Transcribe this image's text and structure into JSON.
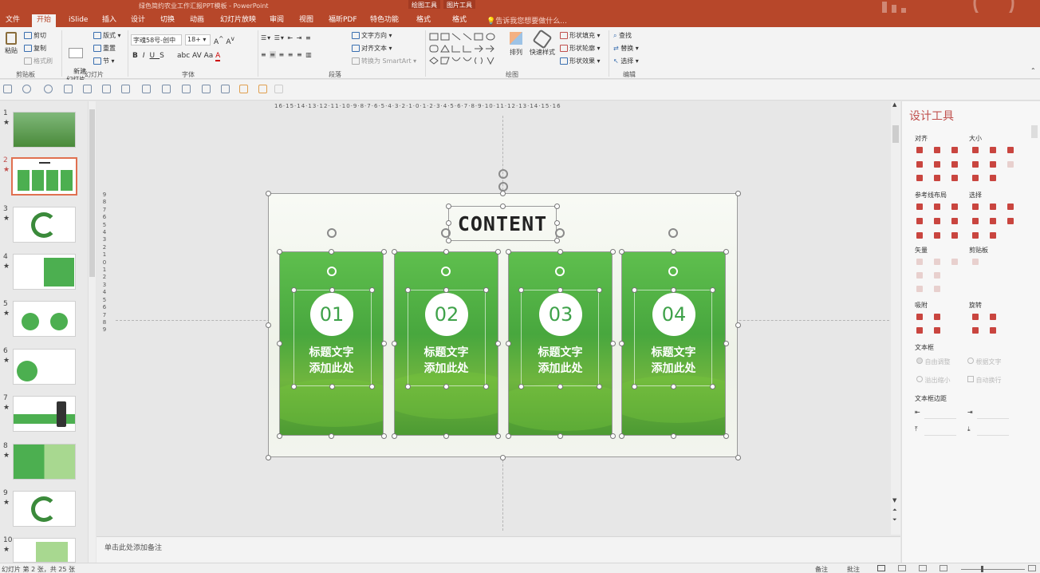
{
  "window": {
    "title": "绿色简约农业工作汇报PPT模板 - PowerPoint",
    "context_tabs": [
      "绘图工具",
      "图片工具"
    ]
  },
  "tabs": [
    "文件",
    "开始",
    "iSlide",
    "插入",
    "设计",
    "切换",
    "动画",
    "幻灯片放映",
    "审阅",
    "视图",
    "福昕PDF",
    "特色功能",
    "格式",
    "格式"
  ],
  "active_tab": "开始",
  "tell_me": "告诉我您想要做什么...",
  "ribbon": {
    "clipboard": {
      "paste": "粘贴",
      "cut": "剪切",
      "copy": "复制",
      "format_painter": "格式刷",
      "group": "剪贴板"
    },
    "slides": {
      "new_slide": "新建\n幻灯片",
      "layout": "版式",
      "reset": "重置",
      "section": "节",
      "group": "幻灯片"
    },
    "font": {
      "font_name": "字魂58号-创中",
      "font_size": "18+",
      "group": "字体"
    },
    "paragraph": {
      "text_direction": "文字方向",
      "align_text": "对齐文本",
      "smartart": "转换为 SmartArt",
      "group": "段落"
    },
    "drawing": {
      "arrange": "排列",
      "quick_styles": "快速样式",
      "fill": "形状填充",
      "outline": "形状轮廓",
      "effects": "形状效果",
      "group": "绘图"
    },
    "editing": {
      "find": "查找",
      "replace": "替换",
      "select": "选择",
      "group": "编辑"
    }
  },
  "thumbnails": [
    {
      "num": "1",
      "star": "★"
    },
    {
      "num": "2",
      "star": "★"
    },
    {
      "num": "3",
      "star": "★"
    },
    {
      "num": "4",
      "star": "★"
    },
    {
      "num": "5",
      "star": "★"
    },
    {
      "num": "6",
      "star": "★"
    },
    {
      "num": "7",
      "star": "★"
    },
    {
      "num": "8",
      "star": "★"
    },
    {
      "num": "9",
      "star": "★"
    },
    {
      "num": "10",
      "star": "★"
    }
  ],
  "selected_slide": "2",
  "rulers": {
    "horizontal": "16·15·14·13·12·11·10·9·8·7·6·5·4·3·2·1·0·1·2·3·4·5·6·7·8·9·10·11·12·13·14·15·16",
    "vertical": [
      "9",
      "8",
      "7",
      "6",
      "5",
      "4",
      "3",
      "2",
      "1",
      "0",
      "1",
      "2",
      "3",
      "4",
      "5",
      "6",
      "7",
      "8",
      "9"
    ]
  },
  "slide": {
    "title": "CONTENT",
    "cards": [
      {
        "num": "01",
        "line1": "标题文字",
        "line2": "添加此处"
      },
      {
        "num": "02",
        "line1": "标题文字",
        "line2": "添加此处"
      },
      {
        "num": "03",
        "line1": "标题文字",
        "line2": "添加此处"
      },
      {
        "num": "04",
        "line1": "标题文字",
        "line2": "添加此处"
      }
    ]
  },
  "notes_placeholder": "单击此处添加备注",
  "design_panel": {
    "title": "设计工具",
    "sections": [
      "对齐",
      "大小",
      "参考线布局",
      "选择",
      "矢量",
      "剪贴板",
      "吸附",
      "旋转",
      "文本框",
      "文本框边距"
    ],
    "textbox_options": [
      "自由调整",
      "根据文字",
      "溢出缩小",
      "自动换行"
    ]
  },
  "status": {
    "slide_info": "幻灯片 第 2 张，共 25 张",
    "notes": "备注",
    "comments": "批注"
  },
  "colors": {
    "accent": "#b7472a",
    "card_green": "#4caf50",
    "panel_red": "#c0504d"
  }
}
